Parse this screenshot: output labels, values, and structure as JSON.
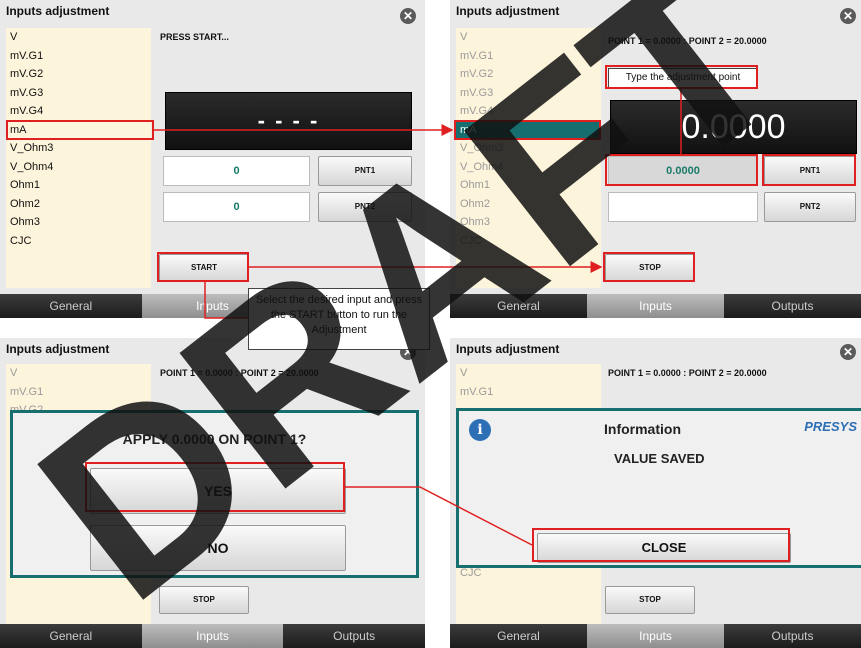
{
  "title": "Inputs adjustment",
  "inputs": [
    "V",
    "mV.G1",
    "mV.G2",
    "mV.G3",
    "mV.G4",
    "mA",
    "V_Ohm3",
    "V_Ohm4",
    "Ohm1",
    "Ohm2",
    "Ohm3",
    "CJC"
  ],
  "tabs": [
    "General",
    "Inputs",
    "Outputs"
  ],
  "panel1": {
    "status": "PRESS START...",
    "display": "- - - -",
    "point1_value": "0",
    "point2_value": "0",
    "pnt1": "PNT1",
    "pnt2": "PNT2",
    "start": "START"
  },
  "panel2": {
    "status": "POINT 1 = 0.0000 : POINT 2 = 20.0000",
    "display": "0.0000",
    "point1_value": "0.0000",
    "pnt1": "PNT1",
    "pnt2": "PNT2",
    "stop": "STOP",
    "tooltip": "Type the adjustment point"
  },
  "panel3": {
    "status": "POINT 1 = 0.0000 : POINT 2 = 20.0000",
    "dialog_question": "APPLY 0.0000 ON POINT 1?",
    "yes": "YES",
    "no": "NO",
    "stop": "STOP"
  },
  "panel4": {
    "status": "POINT 1 = 0.0000 : POINT 2 = 20.0000",
    "info_title": "Information",
    "info_brand": "PRESYS",
    "info_message": "VALUE SAVED",
    "close": "CLOSE",
    "stop": "STOP"
  },
  "callout": "Select the desired input and press the START button to run the Adjustment",
  "watermark": "DRAFT",
  "colors": {
    "accent": "#176e6e",
    "annotation": "#e02020",
    "list_bg": "#fdf4dc"
  }
}
